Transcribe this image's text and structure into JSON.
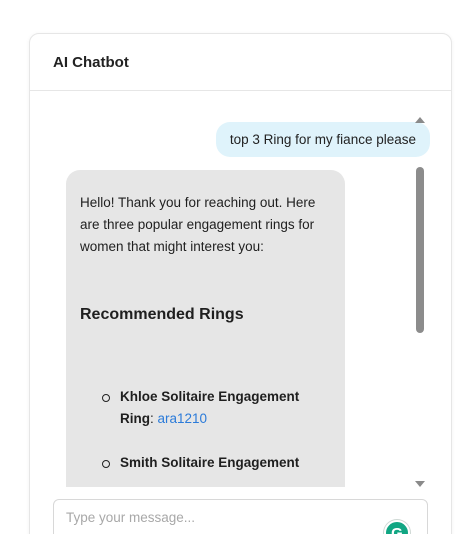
{
  "header": {
    "title": "AI Chatbot"
  },
  "messages": {
    "user": "top 3 Ring for my fiance please",
    "bot": {
      "intro": "Hello! Thank you for reaching out. Here are three popular engagement rings for women that might interest you:",
      "heading": "Recommended Rings",
      "rings": [
        {
          "name": "Khloe Solitaire Engagement Ring",
          "separator": ": ",
          "code": "ara1210"
        },
        {
          "name": "Smith Solitaire Engagement",
          "separator": "",
          "code": ""
        }
      ]
    }
  },
  "input": {
    "placeholder": "Type your message...",
    "value": ""
  },
  "grammarly": {
    "icon": "grammarly-icon",
    "letter": "G"
  },
  "colors": {
    "user_bubble": "#dff3fb",
    "bot_bubble": "#e6e6e6",
    "link": "#2b7bd9",
    "grammarly": "#11a683"
  }
}
